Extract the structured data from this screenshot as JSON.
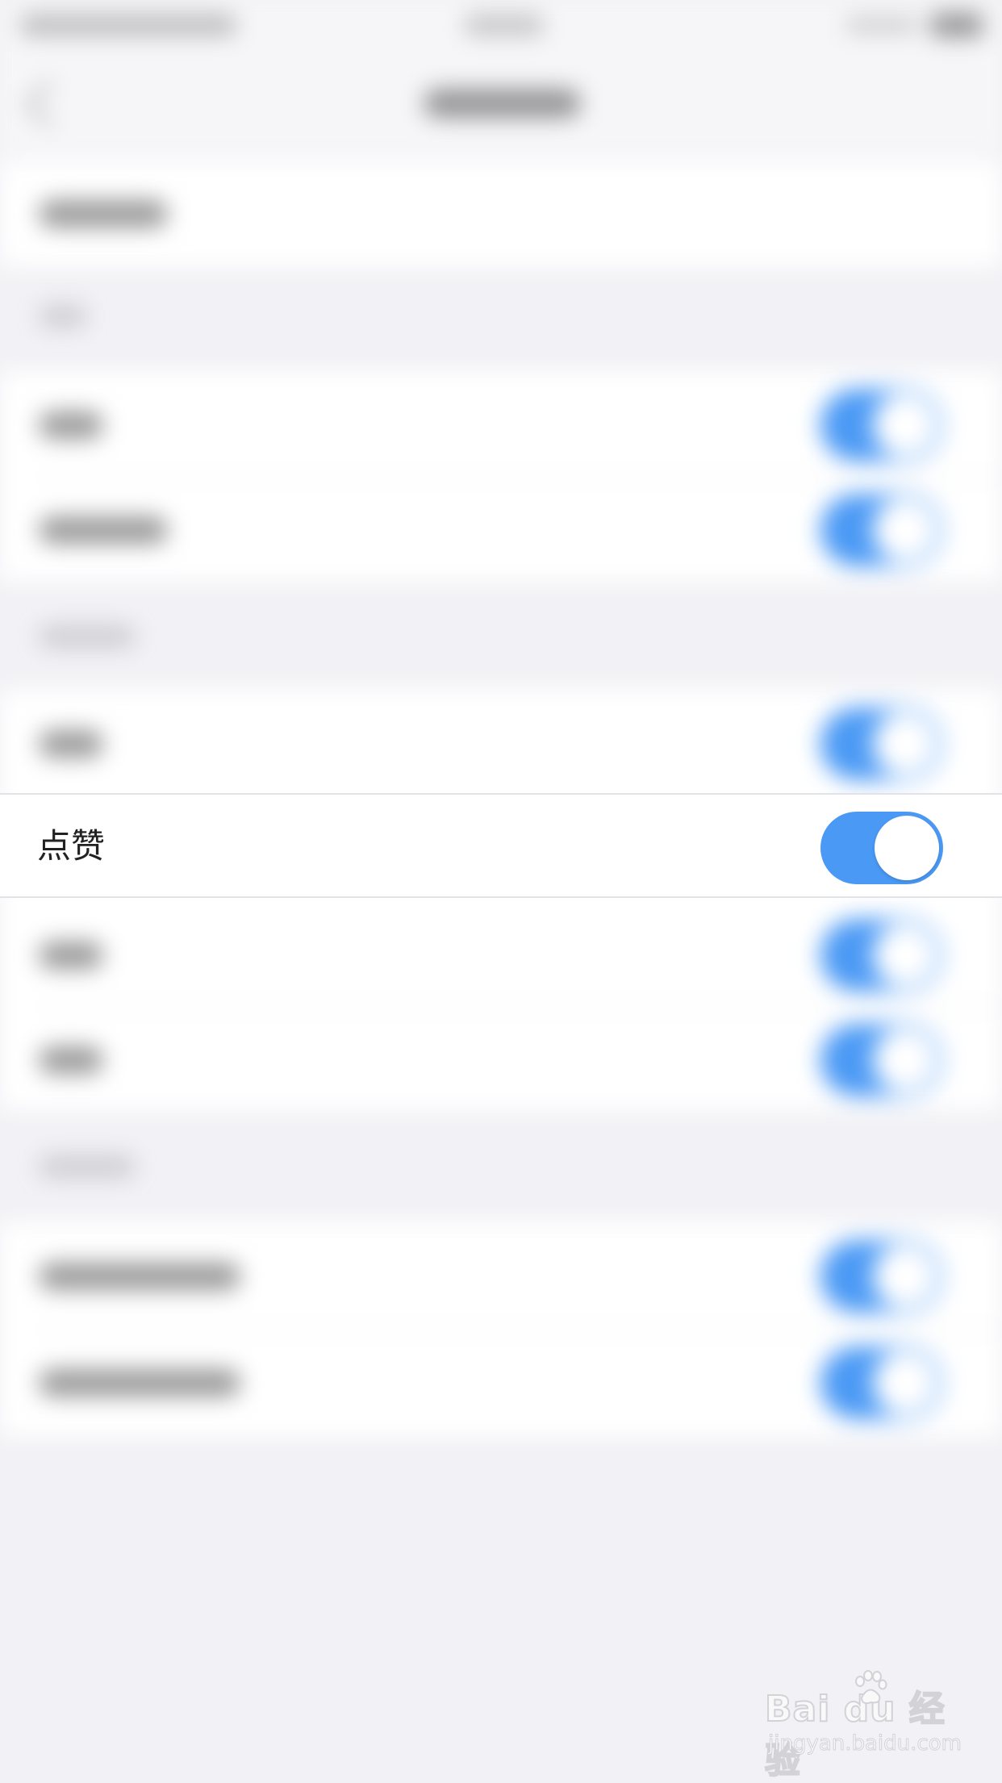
{
  "focused_setting": {
    "label": "点赞",
    "toggle_on": true,
    "toggle_color": "#4a99f5"
  },
  "background": {
    "blurred": true,
    "toggle_color": "#4a99f5",
    "section_background": "#f2f2f6"
  },
  "watermark": {
    "logo": "Bai du 经验",
    "url": "jingyan.baidu.com"
  }
}
